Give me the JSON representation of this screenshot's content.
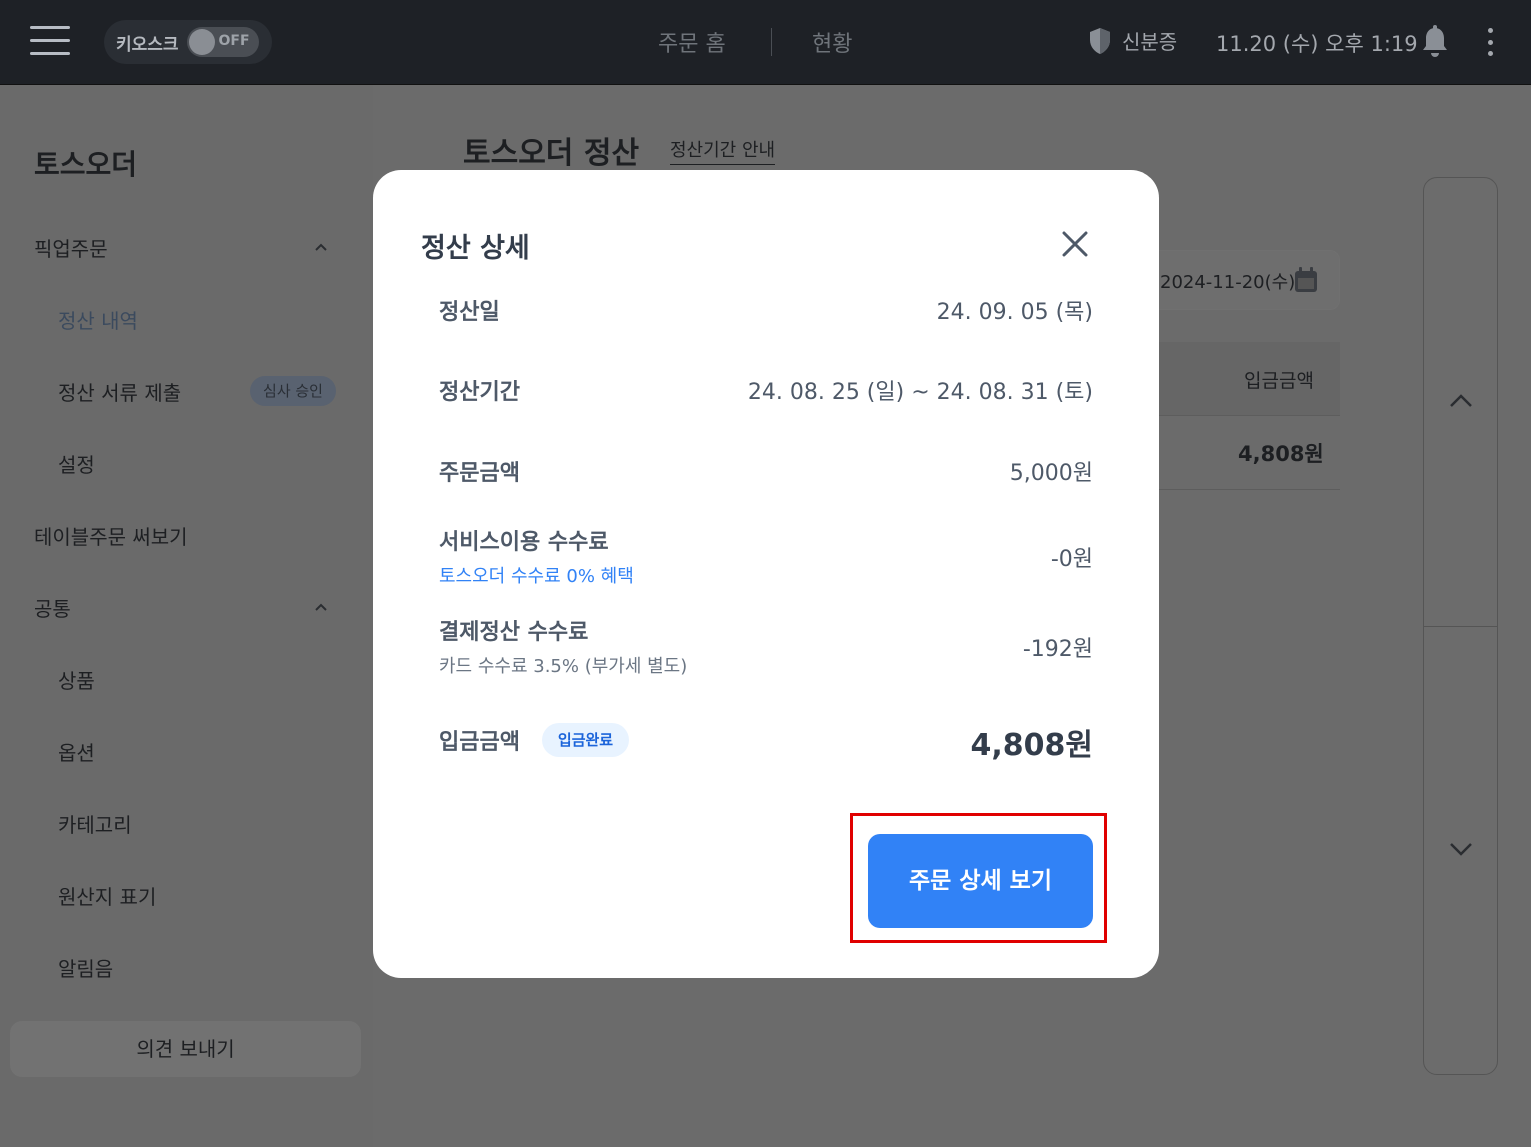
{
  "topbar": {
    "kiosk_label": "키오스크",
    "kiosk_toggle": "OFF",
    "nav_home": "주문 홈",
    "nav_status": "현황",
    "id_label": "신분증",
    "datetime": "11.20 (수) 오후 1:19"
  },
  "sidebar": {
    "title": "토스오더",
    "pickup": "픽업주문",
    "settlement_history": "정산 내역",
    "doc_submit": "정산 서류 제출",
    "doc_badge": "심사 승인",
    "settings": "설정",
    "table_order": "테이블주문 써보기",
    "common": "공통",
    "products": "상품",
    "options": "옵션",
    "categories": "카테고리",
    "origin": "원산지 표기",
    "alarm": "알림음",
    "feedback": "의견 보내기"
  },
  "main": {
    "title": "토스오더 정산",
    "period_info": "정산기간 안내",
    "date": "2024-11-20(수)",
    "col_amount": "입금금액",
    "row_amount": "4,808원"
  },
  "modal": {
    "title": "정산 상세",
    "rows": [
      {
        "label": "정산일",
        "value": "24. 09. 05 (목)"
      },
      {
        "label": "정산기간",
        "value": "24. 08. 25 (일) ~ 24. 08. 31 (토)"
      },
      {
        "label": "주문금액",
        "value": "5,000원"
      },
      {
        "label": "서비스이용 수수료",
        "sub": "토스오더 수수료 0% 혜택",
        "value": "-0원"
      },
      {
        "label": "결제정산 수수료",
        "sub": "카드 수수료 3.5% (부가세 별도)",
        "value": "-192원"
      }
    ],
    "deposit_label": "입금금액",
    "deposit_badge": "입금완료",
    "deposit_total": "4,808원",
    "detail_button": "주문 상세 보기"
  },
  "colors": {
    "accent": "#3182f6",
    "highlight": "#e00000"
  }
}
